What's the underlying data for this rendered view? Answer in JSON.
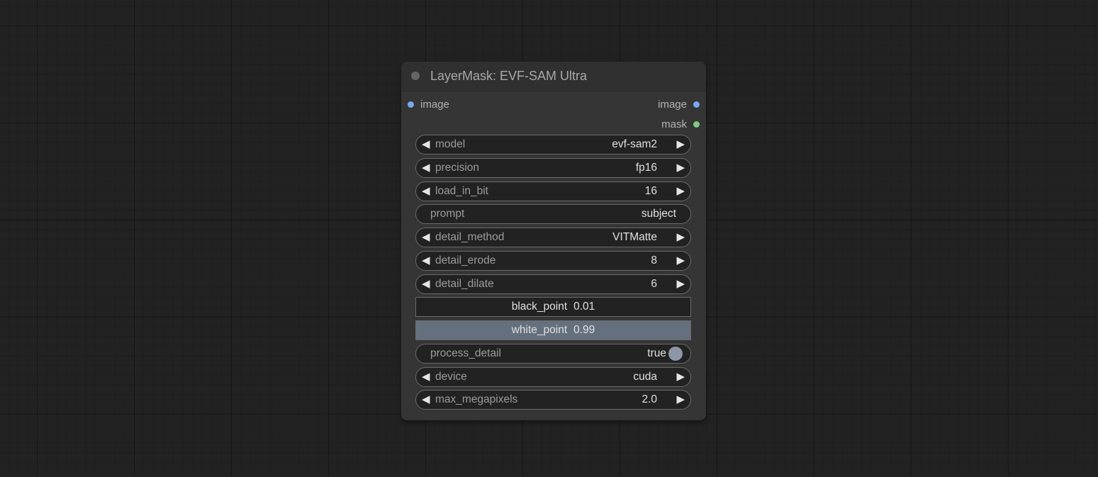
{
  "node": {
    "title": "LayerMask: EVF-SAM Ultra",
    "inputs": [
      {
        "label": "image"
      }
    ],
    "outputs": [
      {
        "label": "image"
      },
      {
        "label": "mask"
      }
    ],
    "widgets": {
      "model": {
        "label": "model",
        "value": "evf-sam2"
      },
      "precision": {
        "label": "precision",
        "value": "fp16"
      },
      "load_in_bit": {
        "label": "load_in_bit",
        "value": "16"
      },
      "prompt": {
        "label": "prompt",
        "value": "subject"
      },
      "detail_method": {
        "label": "detail_method",
        "value": "VITMatte"
      },
      "detail_erode": {
        "label": "detail_erode",
        "value": "8"
      },
      "detail_dilate": {
        "label": "detail_dilate",
        "value": "6"
      },
      "black_point": {
        "label": "black_point",
        "value": "0.01"
      },
      "white_point": {
        "label": "white_point",
        "value": "0.99"
      },
      "process_detail": {
        "label": "process_detail",
        "value": "true"
      },
      "device": {
        "label": "device",
        "value": "cuda"
      },
      "max_megapixels": {
        "label": "max_megapixels",
        "value": "2.0"
      }
    }
  },
  "colors": {
    "canvas": "#222222",
    "node_body": "#353535",
    "image_slot": "#79a9ee",
    "mask_slot": "#81c784",
    "slider_fill": "#65707f"
  }
}
